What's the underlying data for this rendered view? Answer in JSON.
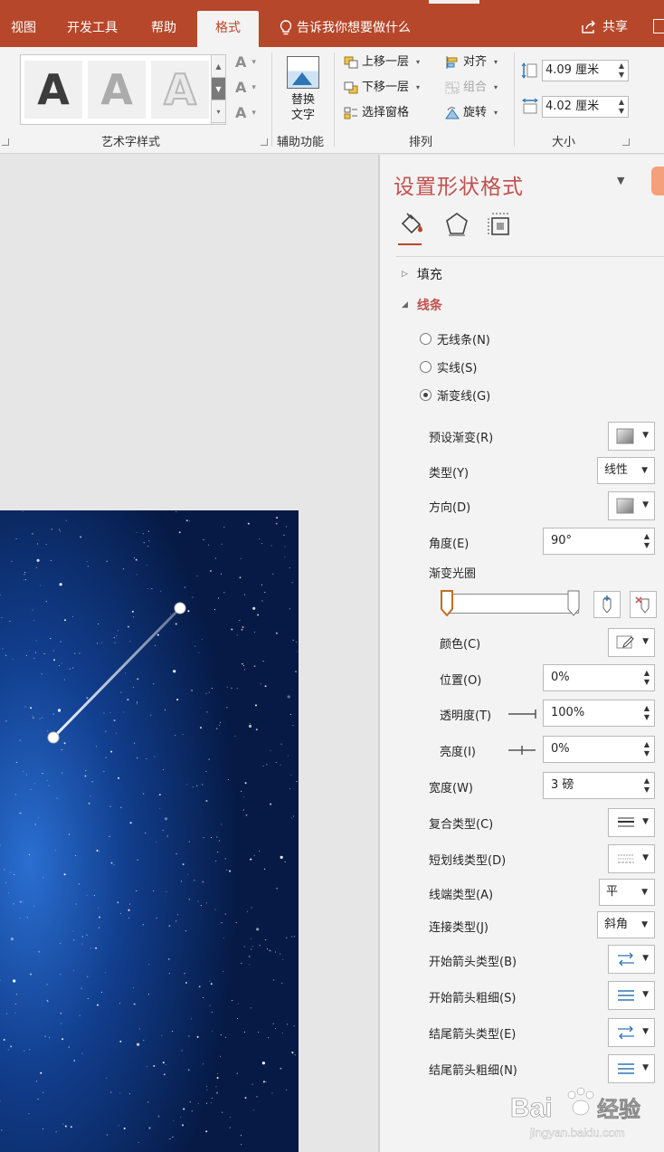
{
  "tabs": [
    {
      "label": "视图",
      "active": false
    },
    {
      "label": "开发工具",
      "active": false
    },
    {
      "label": "帮助",
      "active": false
    },
    {
      "label": "格式",
      "active": true
    }
  ],
  "tell_me": "告诉我你想要做什么",
  "share": "共享",
  "ribbon": {
    "wordart_group": "艺术字样式",
    "wordart_styles": [
      "A",
      "A",
      "A"
    ],
    "text_effects": [
      "A",
      "A",
      "A"
    ],
    "accessibility_group": "辅助功能",
    "alt_text_line1": "替换",
    "alt_text_line2": "文字",
    "arrange_group": "排列",
    "bring_forward": "上移一层",
    "send_backward": "下移一层",
    "selection_pane": "选择窗格",
    "align": "对齐",
    "group": "组合",
    "rotate": "旋转",
    "size_group": "大小",
    "height": "4.09 厘米",
    "width": "4.02 厘米"
  },
  "pane": {
    "title": "设置形状格式",
    "fill": "填充",
    "line": "线条",
    "radio_no_line": "无线条(N)",
    "radio_solid": "实线(S)",
    "radio_gradient": "渐变线(G)",
    "selected_radio": "gradient",
    "preset_gradient": "预设渐变(R)",
    "type_label": "类型(Y)",
    "type_value": "线性",
    "direction_label": "方向(D)",
    "angle_label": "角度(E)",
    "angle_value": "90°",
    "gradient_stops": "渐变光圈",
    "color_label": "颜色(C)",
    "position_label": "位置(O)",
    "position_value": "0%",
    "transparency_label": "透明度(T)",
    "transparency_value": "100%",
    "brightness_label": "亮度(I)",
    "brightness_value": "0%",
    "width_label": "宽度(W)",
    "width_value": "3 磅",
    "compound_label": "复合类型(C)",
    "dash_label": "短划线类型(D)",
    "cap_label": "线端类型(A)",
    "cap_value": "平",
    "join_label": "连接类型(J)",
    "join_value": "斜角",
    "begin_arrow_type": "开始箭头类型(B)",
    "begin_arrow_size": "开始箭头粗细(S)",
    "end_arrow_type": "结尾箭头类型(E)",
    "end_arrow_size": "结尾箭头粗细(N)"
  },
  "watermark": {
    "brand": "Bai",
    "brand2": "经验",
    "url": "jingyan.baidu.com"
  },
  "colors": {
    "accent": "#b7472a",
    "pane_title": "#c0504d",
    "ribbon_bg": "#f3f3f3"
  }
}
